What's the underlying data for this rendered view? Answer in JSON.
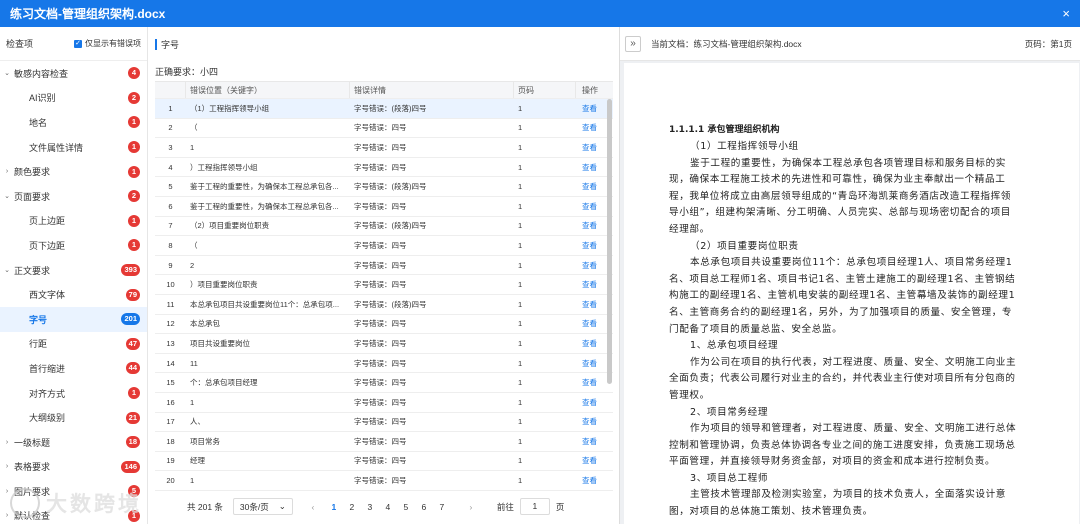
{
  "window": {
    "title": "练习文档-管理组织架构.docx",
    "close_icon": "×"
  },
  "sidebar": {
    "header": "检查项",
    "only_errors_label": "仅显示有错误项",
    "items": [
      {
        "label": "敏感内容检查",
        "count": "4",
        "level": 1,
        "expanded": true
      },
      {
        "label": "AI识别",
        "count": "2",
        "level": 2
      },
      {
        "label": "地名",
        "count": "1",
        "level": 2
      },
      {
        "label": "文件属性详情",
        "count": "1",
        "level": 2
      },
      {
        "label": "颜色要求",
        "count": "1",
        "level": 1,
        "expanded": false
      },
      {
        "label": "页面要求",
        "count": "2",
        "level": 1,
        "expanded": true
      },
      {
        "label": "页上边距",
        "count": "1",
        "level": 2
      },
      {
        "label": "页下边距",
        "count": "1",
        "level": 2
      },
      {
        "label": "正文要求",
        "count": "393",
        "level": 1,
        "expanded": true
      },
      {
        "label": "西文字体",
        "count": "79",
        "level": 2
      },
      {
        "label": "字号",
        "count": "201",
        "level": 2,
        "active": true
      },
      {
        "label": "行距",
        "count": "47",
        "level": 2
      },
      {
        "label": "首行缩进",
        "count": "44",
        "level": 2
      },
      {
        "label": "对齐方式",
        "count": "1",
        "level": 2
      },
      {
        "label": "大纲级别",
        "count": "21",
        "level": 2
      },
      {
        "label": "一级标题",
        "count": "18",
        "level": 1,
        "expanded": false
      },
      {
        "label": "表格要求",
        "count": "146",
        "level": 1,
        "expanded": false
      },
      {
        "label": "图片要求",
        "count": "5",
        "level": 1,
        "expanded": false
      },
      {
        "label": "默认检查",
        "count": "1",
        "level": 1,
        "expanded": false
      }
    ]
  },
  "main": {
    "section_title": "字号",
    "requirement": "正确要求：小四",
    "columns": [
      "",
      "错误位置（关键字）",
      "错误详情",
      "页码",
      "操作"
    ],
    "rows": [
      {
        "no": "1",
        "pos": "（1）工程指挥领导小组",
        "detail": "字号错误：(段落)四号",
        "page": "1",
        "op": "查看"
      },
      {
        "no": "2",
        "pos": "（",
        "detail": "字号错误：四号",
        "page": "1",
        "op": "查看"
      },
      {
        "no": "3",
        "pos": "1",
        "detail": "字号错误：四号",
        "page": "1",
        "op": "查看"
      },
      {
        "no": "4",
        "pos": "）工程指挥领导小组",
        "detail": "字号错误：四号",
        "page": "1",
        "op": "查看"
      },
      {
        "no": "5",
        "pos": "鉴于工程的重要性，为确保本工程总承包各...",
        "detail": "字号错误：(段落)四号",
        "page": "1",
        "op": "查看"
      },
      {
        "no": "6",
        "pos": "鉴于工程的重要性，为确保本工程总承包各...",
        "detail": "字号错误：四号",
        "page": "1",
        "op": "查看"
      },
      {
        "no": "7",
        "pos": "（2）项目重要岗位职责",
        "detail": "字号错误：(段落)四号",
        "page": "1",
        "op": "查看"
      },
      {
        "no": "8",
        "pos": "（",
        "detail": "字号错误：四号",
        "page": "1",
        "op": "查看"
      },
      {
        "no": "9",
        "pos": "2",
        "detail": "字号错误：四号",
        "page": "1",
        "op": "查看"
      },
      {
        "no": "10",
        "pos": "）项目重要岗位职责",
        "detail": "字号错误：四号",
        "page": "1",
        "op": "查看"
      },
      {
        "no": "11",
        "pos": "本总承包项目共设重要岗位11个：总承包项...",
        "detail": "字号错误：(段落)四号",
        "page": "1",
        "op": "查看"
      },
      {
        "no": "12",
        "pos": "本总承包",
        "detail": "字号错误：四号",
        "page": "1",
        "op": "查看"
      },
      {
        "no": "13",
        "pos": "项目共设重要岗位",
        "detail": "字号错误：四号",
        "page": "1",
        "op": "查看"
      },
      {
        "no": "14",
        "pos": "11",
        "detail": "字号错误：四号",
        "page": "1",
        "op": "查看"
      },
      {
        "no": "15",
        "pos": "个：总承包项目经理",
        "detail": "字号错误：四号",
        "page": "1",
        "op": "查看"
      },
      {
        "no": "16",
        "pos": "1",
        "detail": "字号错误：四号",
        "page": "1",
        "op": "查看"
      },
      {
        "no": "17",
        "pos": "人、",
        "detail": "字号错误：四号",
        "page": "1",
        "op": "查看"
      },
      {
        "no": "18",
        "pos": "项目常务",
        "detail": "字号错误：四号",
        "page": "1",
        "op": "查看"
      },
      {
        "no": "19",
        "pos": "经理",
        "detail": "字号错误：四号",
        "page": "1",
        "op": "查看"
      },
      {
        "no": "20",
        "pos": "1",
        "detail": "字号错误：四号",
        "page": "1",
        "op": "查看"
      }
    ],
    "pagination": {
      "total": "共 201 条",
      "page_size": "30条/页",
      "prev": "‹",
      "pages": [
        "1",
        "2",
        "3",
        "4",
        "5",
        "6",
        "7"
      ],
      "current": "1",
      "next": "›",
      "goto_label": "前往",
      "goto_value": "1",
      "goto_suffix": "页"
    }
  },
  "preview": {
    "expand_icon": "»",
    "current_doc": "当前文档：练习文档-管理组织架构.docx",
    "page_info": "页码：第1页",
    "heading": "1.1.1.1 承包管理组织机构",
    "paragraphs": [
      "（1）工程指挥领导小组",
      "鉴于工程的重要性，为确保本工程总承包各项管理目标和服务目标的实现，确保本工程施工技术的先进性和可靠性，确保为业主奉献出一个精品工程，我单位将成立由高层领导组成的“青岛环海凯莱商务酒店改造工程指挥领导小组”，组建构架清晰、分工明确、人员完实、总部与现场密切配合的项目经理部。",
      "（2）项目重要岗位职责",
      "本总承包项目共设重要岗位11个：总承包项目经理1人、项目常务经理1名、项目总工程师1名、项目书记1名、主管土建施工的副经理1名、主管钢结构施工的副经理1名、主管机电安装的副经理1名、主管幕墙及装饰的副经理1名、主管商务合约的副经理1名，另外，为了加强项目的质量、安全管理，专门配备了项目的质量总监、安全总监。",
      "1、总承包项目经理",
      "作为公司在项目的执行代表，对工程进度、质量、安全、文明施工向业主全面负责；代表公司履行对业主的合约，并代表业主行使对项目所有分包商的管理权。",
      "2、项目常务经理",
      "作为项目的领导和管理者，对工程进度、质量、安全、文明施工进行总体控制和管理协调，负责总体协调各专业之间的施工进度安排，负责施工现场总平面管理，并直接领导财务资金部，对项目的资金和成本进行控制负责。",
      "3、项目总工程师",
      "主管技术管理部及检测实验室，为项目的技术负责人，全面落实设计意图，对项目的总体施工策划、技术管理负责。"
    ]
  },
  "watermark": "大数跨境",
  "colors": {
    "primary": "#1677e8",
    "badge": "#e53935"
  }
}
